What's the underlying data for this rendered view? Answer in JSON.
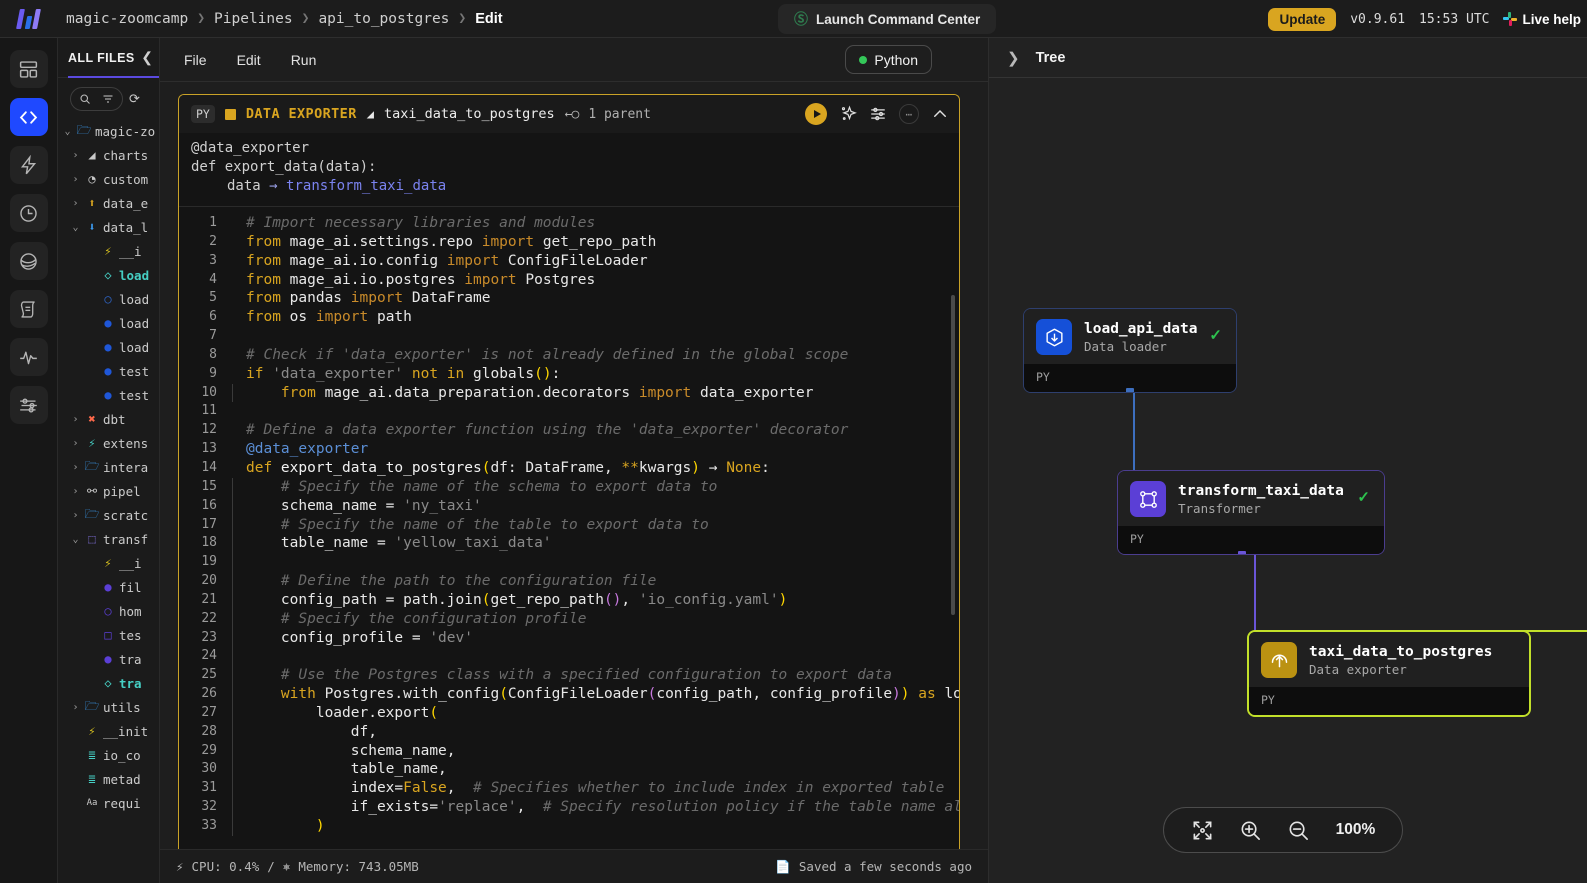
{
  "topbar": {
    "logo_icon": "mage-logo-icon",
    "breadcrumb": [
      "magic-zoomcamp",
      "Pipelines",
      "api_to_postgres",
      "Edit"
    ],
    "launch_command_center": "Launch Command Center",
    "command_center_icon": "command-center-icon",
    "update_label": "Update",
    "version": "v0.9.61",
    "clock": "15:53 UTC",
    "live_help": "Live help",
    "slack_icon": "slack-icon"
  },
  "rail": {
    "items": [
      {
        "name": "dashboard-icon",
        "active": false
      },
      {
        "name": "code-icon",
        "active": true
      },
      {
        "name": "lightning-icon",
        "active": false
      },
      {
        "name": "clock-icon",
        "active": false
      },
      {
        "name": "globe-icon",
        "active": false
      },
      {
        "name": "logs-icon",
        "active": false
      },
      {
        "name": "pulse-icon",
        "active": false
      },
      {
        "name": "sliders-icon",
        "active": false
      }
    ]
  },
  "file_sidebar": {
    "title": "ALL FILES",
    "collapse_icon": "chevron-left-icon",
    "search_icon": "search-icon",
    "filter_icon": "filter-icon",
    "refresh_icon": "refresh-icon",
    "tree": [
      {
        "chev": "v",
        "icon": "folder-icon",
        "color": "#3b9bf0",
        "label": "magic-zo",
        "indent": 0,
        "sel": false
      },
      {
        "chev": ">",
        "icon": "chart-icon",
        "color": "#c9c9c9",
        "label": "charts",
        "indent": 1,
        "sel": false
      },
      {
        "chev": ">",
        "icon": "custom-icon",
        "color": "#c9c9c9",
        "label": "custom",
        "indent": 1,
        "sel": false
      },
      {
        "chev": ">",
        "icon": "exporter-icon",
        "color": "#d9a520",
        "label": "data_e",
        "indent": 1,
        "sel": false
      },
      {
        "chev": "v",
        "icon": "loader-icon",
        "color": "#3b9bf0",
        "label": "data_l",
        "indent": 1,
        "sel": false
      },
      {
        "chev": "",
        "icon": "lightning-icon",
        "color": "#d9c21f",
        "label": "__i",
        "indent": 3,
        "sel": false
      },
      {
        "chev": "",
        "icon": "diamond-icon",
        "color": "#46cfc4",
        "label": "load",
        "indent": 3,
        "sel": true
      },
      {
        "chev": "",
        "icon": "circle-o-icon",
        "color": "#2f66c9",
        "label": "load",
        "indent": 3,
        "sel": false
      },
      {
        "chev": "",
        "icon": "circle-icon",
        "color": "#1f57d8",
        "label": "load",
        "indent": 3,
        "sel": false
      },
      {
        "chev": "",
        "icon": "circle-icon",
        "color": "#1f57d8",
        "label": "load",
        "indent": 3,
        "sel": false
      },
      {
        "chev": "",
        "icon": "circle-icon",
        "color": "#1f57d8",
        "label": "test",
        "indent": 3,
        "sel": false
      },
      {
        "chev": "",
        "icon": "circle-icon",
        "color": "#1f57d8",
        "label": "test",
        "indent": 3,
        "sel": false
      },
      {
        "chev": ">",
        "icon": "dbt-icon",
        "color": "#ff694a",
        "label": "dbt",
        "indent": 1,
        "sel": false
      },
      {
        "chev": ">",
        "icon": "lightning-icon",
        "color": "#46cfc4",
        "label": "extens",
        "indent": 1,
        "sel": false
      },
      {
        "chev": ">",
        "icon": "folder-icon",
        "color": "#3b9bf0",
        "label": "intera",
        "indent": 1,
        "sel": false
      },
      {
        "chev": ">",
        "icon": "pipeline-icon",
        "color": "#c9c9c9",
        "label": "pipel",
        "indent": 1,
        "sel": false
      },
      {
        "chev": ">",
        "icon": "folder-icon",
        "color": "#3b9bf0",
        "label": "scratc",
        "indent": 1,
        "sel": false
      },
      {
        "chev": "v",
        "icon": "transformer-icon",
        "color": "#8f7bf5",
        "label": "transf",
        "indent": 1,
        "sel": false
      },
      {
        "chev": "",
        "icon": "lightning-icon",
        "color": "#d9c21f",
        "label": "__i",
        "indent": 3,
        "sel": false
      },
      {
        "chev": "",
        "icon": "circle-icon",
        "color": "#5b3fd6",
        "label": "fil",
        "indent": 3,
        "sel": false
      },
      {
        "chev": "",
        "icon": "circle-o-icon",
        "color": "#5b3fd6",
        "label": "hom",
        "indent": 3,
        "sel": false
      },
      {
        "chev": "",
        "icon": "square-o-icon",
        "color": "#5b3fd6",
        "label": "tes",
        "indent": 3,
        "sel": false
      },
      {
        "chev": "",
        "icon": "circle-icon",
        "color": "#5b3fd6",
        "label": "tra",
        "indent": 3,
        "sel": false
      },
      {
        "chev": "",
        "icon": "diamond-icon",
        "color": "#46cfc4",
        "label": "tra",
        "indent": 3,
        "sel": true
      },
      {
        "chev": ">",
        "icon": "folder-icon",
        "color": "#3b9bf0",
        "label": "utils",
        "indent": 1,
        "sel": false
      },
      {
        "chev": "",
        "icon": "lightning-icon",
        "color": "#d9c21f",
        "label": "__init",
        "indent": 1,
        "sel": false
      },
      {
        "chev": "",
        "icon": "yaml-icon",
        "color": "#46cfc4",
        "label": "io_co",
        "indent": 1,
        "sel": false
      },
      {
        "chev": "",
        "icon": "yaml-icon",
        "color": "#46cfc4",
        "label": "metad",
        "indent": 1,
        "sel": false
      },
      {
        "chev": "",
        "icon": "text-icon",
        "color": "#c9c9c9",
        "label": "requi",
        "indent": 1,
        "sel": false
      }
    ]
  },
  "editor": {
    "menu": [
      "File",
      "Edit",
      "Run"
    ],
    "kernel_label": "Python",
    "kernel_status_color": "#34c759",
    "block": {
      "lang_chip": "PY",
      "type_label": "DATA EXPORTER",
      "file_icon": "file-icon",
      "name": "taxi_data_to_postgres",
      "parent_icon": "parent-link-icon",
      "parent_text": "1 parent",
      "run_icon": "play-icon",
      "ai_icon": "sparkle-icon",
      "settings_icon": "sliders-icon",
      "more_icon": "more-icon",
      "collapse_icon": "chevron-up-icon"
    },
    "callout": {
      "line1": "@data_exporter",
      "line2": "def export_data(data):",
      "line3_prefix": "data",
      "line3_arrow": "→",
      "line3_link": "transform_taxi_data"
    },
    "code_lines": [
      {
        "n": 1,
        "indent": 0,
        "tokens": [
          {
            "t": "cm",
            "v": "# Import necessary libraries and modules"
          }
        ]
      },
      {
        "n": 2,
        "indent": 0,
        "tokens": [
          {
            "t": "kw",
            "v": "from "
          },
          {
            "t": "id",
            "v": "mage_ai.settings.repo "
          },
          {
            "t": "kw2",
            "v": "import "
          },
          {
            "t": "id",
            "v": "get_repo_path"
          }
        ]
      },
      {
        "n": 3,
        "indent": 0,
        "tokens": [
          {
            "t": "kw",
            "v": "from "
          },
          {
            "t": "id",
            "v": "mage_ai.io.config "
          },
          {
            "t": "kw2",
            "v": "import "
          },
          {
            "t": "id",
            "v": "ConfigFileLoader"
          }
        ]
      },
      {
        "n": 4,
        "indent": 0,
        "tokens": [
          {
            "t": "kw",
            "v": "from "
          },
          {
            "t": "id",
            "v": "mage_ai.io.postgres "
          },
          {
            "t": "kw2",
            "v": "import "
          },
          {
            "t": "id",
            "v": "Postgres"
          }
        ]
      },
      {
        "n": 5,
        "indent": 0,
        "tokens": [
          {
            "t": "kw",
            "v": "from "
          },
          {
            "t": "id",
            "v": "pandas "
          },
          {
            "t": "kw2",
            "v": "import "
          },
          {
            "t": "id",
            "v": "DataFrame"
          }
        ]
      },
      {
        "n": 6,
        "indent": 0,
        "tokens": [
          {
            "t": "kw",
            "v": "from "
          },
          {
            "t": "id",
            "v": "os "
          },
          {
            "t": "kw2",
            "v": "import "
          },
          {
            "t": "id",
            "v": "path"
          }
        ]
      },
      {
        "n": 7,
        "indent": 0,
        "tokens": []
      },
      {
        "n": 8,
        "indent": 0,
        "tokens": [
          {
            "t": "cm",
            "v": "# Check if 'data_exporter' is not already defined in the global scope"
          }
        ]
      },
      {
        "n": 9,
        "indent": 0,
        "tokens": [
          {
            "t": "kw",
            "v": "if "
          },
          {
            "t": "str",
            "v": "'data_exporter' "
          },
          {
            "t": "kw",
            "v": "not in "
          },
          {
            "t": "id",
            "v": "globals"
          },
          {
            "t": "pl",
            "v": "()"
          },
          {
            "t": "id",
            "v": ":"
          }
        ]
      },
      {
        "n": 10,
        "indent": 1,
        "tokens": [
          {
            "t": "kw",
            "v": "    from "
          },
          {
            "t": "id",
            "v": "mage_ai.data_preparation.decorators "
          },
          {
            "t": "kw2",
            "v": "import "
          },
          {
            "t": "id",
            "v": "data_exporter"
          }
        ]
      },
      {
        "n": 11,
        "indent": 0,
        "tokens": []
      },
      {
        "n": 12,
        "indent": 0,
        "tokens": [
          {
            "t": "cm",
            "v": "# Define a data exporter function using the 'data_exporter' decorator"
          }
        ]
      },
      {
        "n": 13,
        "indent": 0,
        "tokens": [
          {
            "t": "dec",
            "v": "@data_exporter"
          }
        ]
      },
      {
        "n": 14,
        "indent": 0,
        "tokens": [
          {
            "t": "kw",
            "v": "def "
          },
          {
            "t": "fn",
            "v": "export_data_to_postgres"
          },
          {
            "t": "pl",
            "v": "("
          },
          {
            "t": "id",
            "v": "df: DataFrame, "
          },
          {
            "t": "kw",
            "v": "**"
          },
          {
            "t": "id",
            "v": "kwargs"
          },
          {
            "t": "pl",
            "v": ")"
          },
          {
            "t": "id",
            "v": " → "
          },
          {
            "t": "nn",
            "v": "None"
          },
          {
            "t": "id",
            "v": ":"
          }
        ]
      },
      {
        "n": 15,
        "indent": 1,
        "tokens": [
          {
            "t": "cm",
            "v": "    # Specify the name of the schema to export data to"
          }
        ]
      },
      {
        "n": 16,
        "indent": 1,
        "tokens": [
          {
            "t": "id",
            "v": "    schema_name = "
          },
          {
            "t": "str",
            "v": "'ny_taxi'"
          }
        ]
      },
      {
        "n": 17,
        "indent": 1,
        "tokens": [
          {
            "t": "cm",
            "v": "    # Specify the name of the table to export data to"
          }
        ]
      },
      {
        "n": 18,
        "indent": 1,
        "tokens": [
          {
            "t": "id",
            "v": "    table_name = "
          },
          {
            "t": "str",
            "v": "'yellow_taxi_data'"
          }
        ]
      },
      {
        "n": 19,
        "indent": 1,
        "tokens": []
      },
      {
        "n": 20,
        "indent": 1,
        "tokens": [
          {
            "t": "cm",
            "v": "    # Define the path to the configuration file"
          }
        ]
      },
      {
        "n": 21,
        "indent": 1,
        "tokens": [
          {
            "t": "id",
            "v": "    config_path = path.join"
          },
          {
            "t": "pl",
            "v": "("
          },
          {
            "t": "id",
            "v": "get_repo_path"
          },
          {
            "t": "pm",
            "v": "()"
          },
          {
            "t": "id",
            "v": ", "
          },
          {
            "t": "str",
            "v": "'io_config.yaml'"
          },
          {
            "t": "pl",
            "v": ")"
          }
        ]
      },
      {
        "n": 22,
        "indent": 1,
        "tokens": [
          {
            "t": "cm",
            "v": "    # Specify the configuration profile"
          }
        ]
      },
      {
        "n": 23,
        "indent": 1,
        "tokens": [
          {
            "t": "id",
            "v": "    config_profile = "
          },
          {
            "t": "str",
            "v": "'dev'"
          }
        ]
      },
      {
        "n": 24,
        "indent": 1,
        "tokens": []
      },
      {
        "n": 25,
        "indent": 1,
        "tokens": [
          {
            "t": "cm",
            "v": "    # Use the Postgres class with a specified configuration to export data"
          }
        ]
      },
      {
        "n": 26,
        "indent": 1,
        "tokens": [
          {
            "t": "kw",
            "v": "    with "
          },
          {
            "t": "id",
            "v": "Postgres.with_config"
          },
          {
            "t": "pl",
            "v": "("
          },
          {
            "t": "id",
            "v": "ConfigFileLoader"
          },
          {
            "t": "pm",
            "v": "("
          },
          {
            "t": "id",
            "v": "config_path, config_profile"
          },
          {
            "t": "pm",
            "v": ")"
          },
          {
            "t": "pl",
            "v": ")"
          },
          {
            "t": "kw",
            "v": " as "
          },
          {
            "t": "id",
            "v": "load"
          }
        ]
      },
      {
        "n": 27,
        "indent": 2,
        "tokens": [
          {
            "t": "id",
            "v": "        loader.export"
          },
          {
            "t": "pl",
            "v": "("
          }
        ]
      },
      {
        "n": 28,
        "indent": 3,
        "tokens": [
          {
            "t": "id",
            "v": "            df,"
          }
        ]
      },
      {
        "n": 29,
        "indent": 3,
        "tokens": [
          {
            "t": "id",
            "v": "            schema_name,"
          }
        ]
      },
      {
        "n": 30,
        "indent": 3,
        "tokens": [
          {
            "t": "id",
            "v": "            table_name,"
          }
        ]
      },
      {
        "n": 31,
        "indent": 3,
        "tokens": [
          {
            "t": "id",
            "v": "            index="
          },
          {
            "t": "nn",
            "v": "False"
          },
          {
            "t": "id",
            "v": ",  "
          },
          {
            "t": "cm",
            "v": "# Specifies whether to include index in exported table"
          }
        ]
      },
      {
        "n": 32,
        "indent": 3,
        "tokens": [
          {
            "t": "id",
            "v": "            if_exists="
          },
          {
            "t": "str",
            "v": "'replace'"
          },
          {
            "t": "id",
            "v": ",  "
          },
          {
            "t": "cm",
            "v": "# Specify resolution policy if the table name alre"
          }
        ]
      },
      {
        "n": 33,
        "indent": 2,
        "tokens": [
          {
            "t": "pl",
            "v": "        )"
          }
        ]
      }
    ]
  },
  "status_bar": {
    "cpu_icon": "lightning-icon",
    "cpu": "CPU: 0.4%",
    "divider": "/",
    "memory_icon": "memory-icon",
    "memory": "Memory: 743.05MB",
    "save_icon": "save-icon",
    "saved": "Saved a few seconds ago"
  },
  "tree_panel": {
    "expand_icon": "chevron-right-icon",
    "title": "Tree",
    "nodes": [
      {
        "name": "load_api_data",
        "subtitle": "Data loader",
        "icon": "data-loader-icon",
        "lang": "PY",
        "status": "✓",
        "selected": false
      },
      {
        "name": "transform_taxi_data",
        "subtitle": "Transformer",
        "icon": "transformer-icon",
        "lang": "PY",
        "status": "✓",
        "selected": false
      },
      {
        "name": "taxi_data_to_postgres",
        "subtitle": "Data exporter",
        "icon": "data-exporter-icon",
        "lang": "PY",
        "status": "",
        "selected": true
      }
    ],
    "zoom_controls": {
      "fit_icon": "fit-to-screen-icon",
      "zoom_in_icon": "zoom-in-icon",
      "zoom_out_icon": "zoom-out-icon",
      "zoom_level": "100%"
    },
    "colors": {
      "loader": "#1550d8",
      "transformer": "#5b3fd6",
      "exporter": "#bb9212",
      "selected_border": "#c2e02a"
    }
  }
}
